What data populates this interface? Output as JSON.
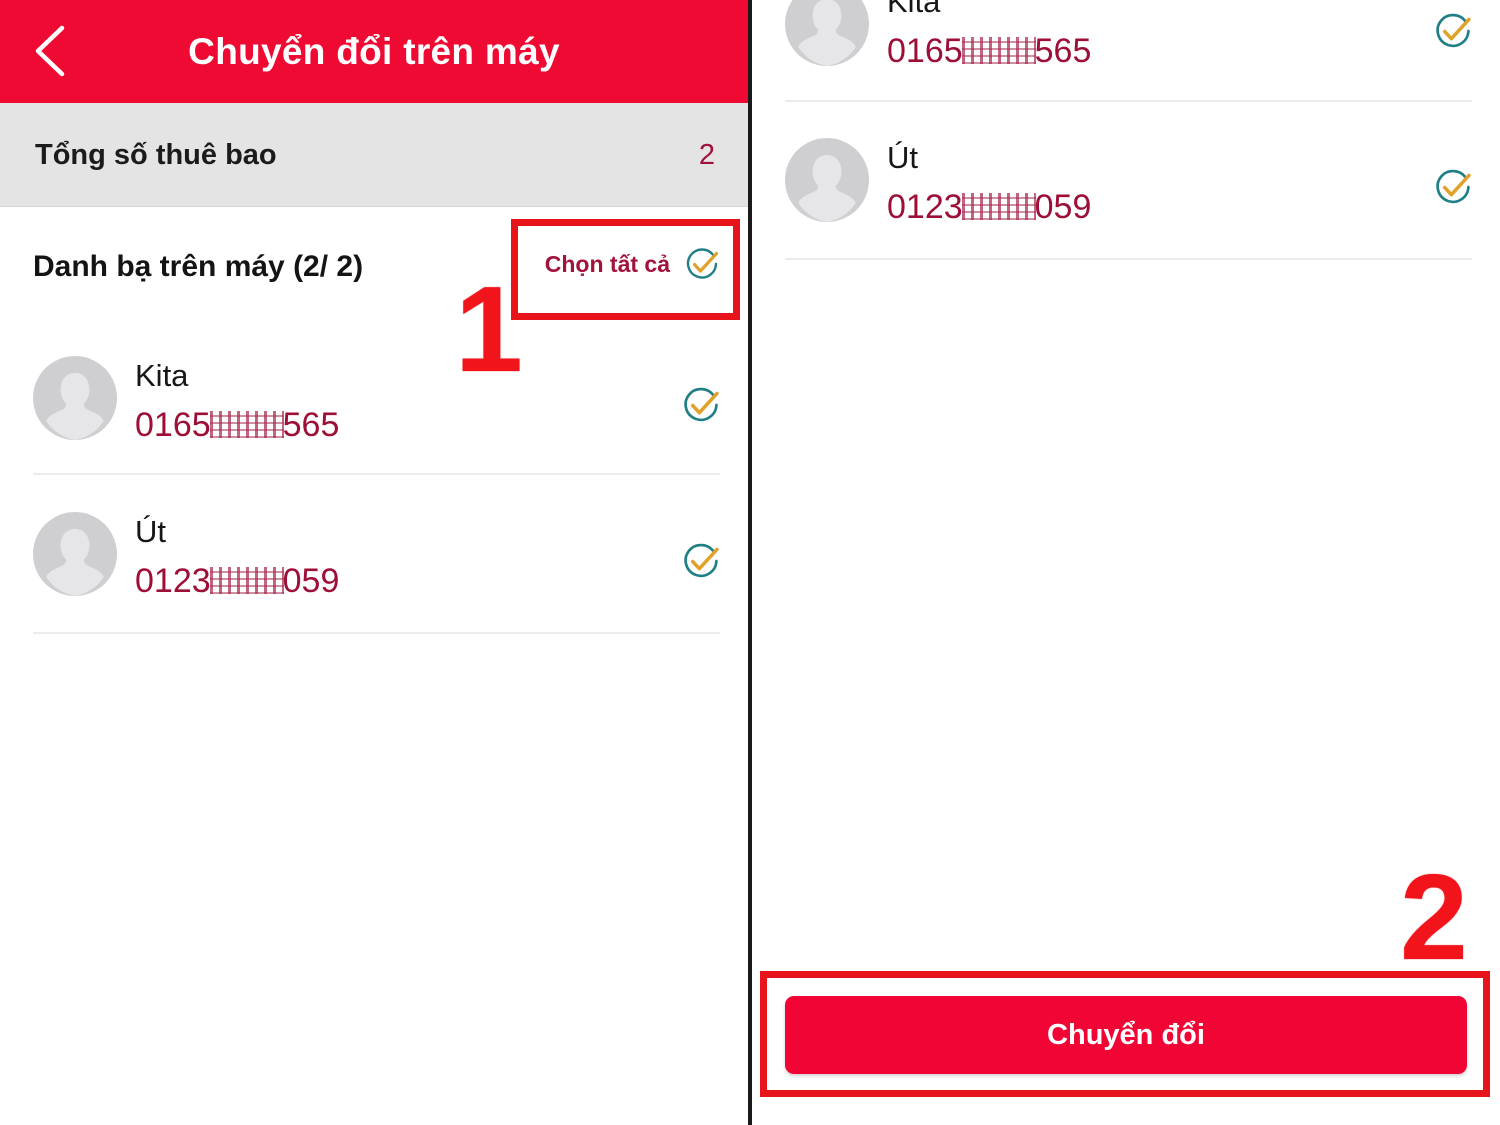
{
  "left_panel": {
    "appbar": {
      "back_icon": "back-chevron-icon",
      "title": "Chuyển đổi trên máy",
      "background_color": "#ee0a33"
    },
    "summary": {
      "label": "Tổng số thuê bao",
      "value": "2"
    },
    "section": {
      "title": "Danh bạ trên máy (2/ 2)",
      "select_all_label": "Chọn tất cả",
      "select_all_icon": "check-circle-icon"
    },
    "contacts": [
      {
        "name": "Kita",
        "number_prefix": "0165",
        "number_suffix": "565",
        "number_masked": true,
        "avatar_icon": "person-avatar-icon",
        "check_icon": "check-circle-icon",
        "checked": true
      },
      {
        "name": "Út",
        "number_prefix": "0123",
        "number_suffix": "059",
        "number_masked": true,
        "avatar_icon": "person-avatar-icon",
        "check_icon": "check-circle-icon",
        "checked": true
      }
    ]
  },
  "right_panel": {
    "contacts": [
      {
        "name": "Kita",
        "number_prefix": "0165",
        "number_suffix": "565",
        "number_masked": true,
        "avatar_icon": "person-avatar-icon",
        "check_icon": "check-circle-icon",
        "checked": true
      },
      {
        "name": "Út",
        "number_prefix": "0123",
        "number_suffix": "059",
        "number_masked": true,
        "avatar_icon": "person-avatar-icon",
        "check_icon": "check-circle-icon",
        "checked": true
      }
    ],
    "cta": {
      "label": "Chuyển đổi",
      "background_color": "#f00534"
    }
  },
  "annotations": {
    "step_one": "1",
    "step_two": "2",
    "highlight_color": "#e8141b"
  },
  "colors": {
    "brand_red": "#ee0a33",
    "number_red": "#9d0f36",
    "check_circle_teal": "#1f7f85",
    "check_mark_gold": "#e0a22a",
    "summary_band_gray": "#e4e4e4"
  }
}
